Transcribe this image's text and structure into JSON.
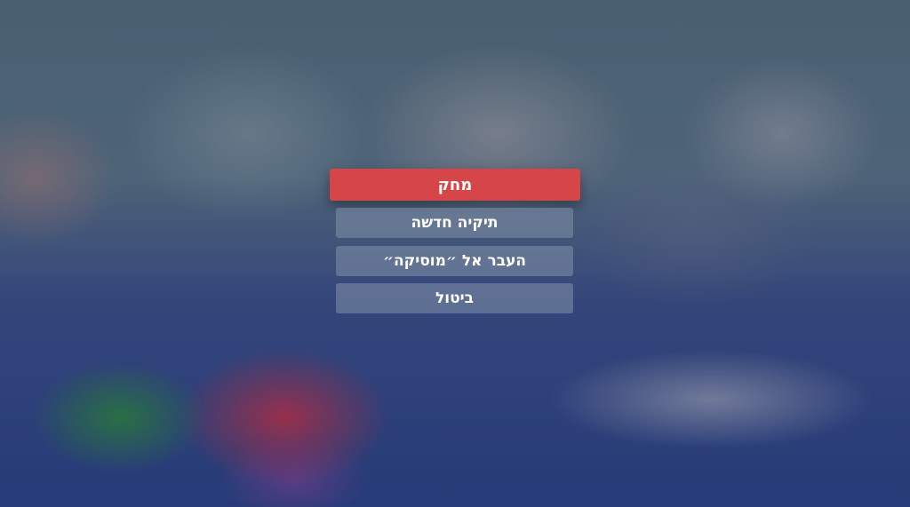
{
  "menu": {
    "delete_label": "מחק",
    "new_folder_label": "תיקיה חדשה",
    "move_to_music_label": "העבר אל ״מוסיקה״",
    "cancel_label": "ביטול"
  },
  "colors": {
    "primary_button": "#d64548",
    "secondary_button": "#8291aa"
  }
}
